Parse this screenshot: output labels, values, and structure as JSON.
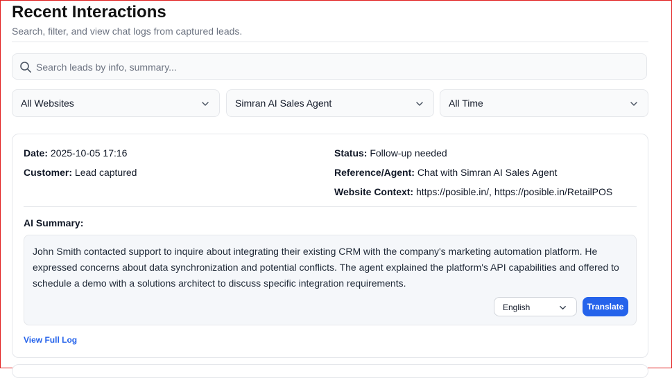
{
  "header": {
    "title": "Recent Interactions",
    "subtitle": "Search, filter, and view chat logs from captured leads."
  },
  "search": {
    "icon": "search-icon",
    "placeholder": "Search leads by info, summary...",
    "value": ""
  },
  "filters": {
    "website": "All Websites",
    "agent": "Simran AI Sales Agent",
    "time": "All Time"
  },
  "interaction": {
    "date_label": "Date:",
    "date_value": "2025-10-05 17:16",
    "customer_label": "Customer:",
    "customer_value": "Lead captured",
    "status_label": "Status:",
    "status_value": "Follow-up needed",
    "reference_label": "Reference/Agent:",
    "reference_value": "Chat with Simran AI Sales Agent",
    "website_label": "Website Context:",
    "website_value": "https://posible.in/, https://posible.in/RetailPOS",
    "summary_label": "AI Summary:",
    "summary_text": "John Smith contacted support to inquire about integrating their existing CRM with the company's marketing automation platform. He expressed concerns about data synchronization and potential conflicts. The agent explained the platform's API capabilities and offered to schedule a demo with a solutions architect to discuss specific integration requirements.",
    "language": "English",
    "translate_label": "Translate",
    "view_log_label": "View Full Log"
  },
  "colors": {
    "accent": "#2563eb",
    "border": "#e5e7eb",
    "summary_bg": "#f5f7fa",
    "frame": "#e11d1d"
  }
}
